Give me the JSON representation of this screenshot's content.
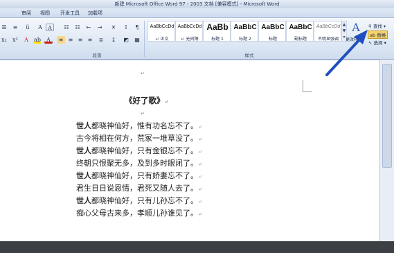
{
  "window": {
    "title": "新建 Microsoft Office Word 97 - 2003 文档 [兼容模式] - Microsoft Word"
  },
  "tabs": [
    "审阅",
    "视图",
    "开发工具",
    "加载项"
  ],
  "ribbon": {
    "paragraph_group_label": "段落",
    "styles_group_label": "样式",
    "styles": [
      {
        "preview": "AaBbCcDd",
        "name": "↵ 正文"
      },
      {
        "preview": "AaBbCcDd",
        "name": "↵ 无间隔"
      },
      {
        "preview": "AaBb",
        "name": "标题 1"
      },
      {
        "preview": "AaBbC",
        "name": "标题 2"
      },
      {
        "preview": "AaBbC",
        "name": "标题"
      },
      {
        "preview": "AaBbC",
        "name": "副标题"
      },
      {
        "preview": "AaBbCcDd",
        "name": "不明显强调"
      }
    ],
    "change_styles_label": "更改样式",
    "edit": {
      "find_label": "查找",
      "replace_label": "替换",
      "select_label": "选择"
    }
  },
  "document": {
    "title": "《好了歌》",
    "lines": [
      {
        "bold": "世人",
        "rest": "都晓神仙好，惟有功名忘不了。"
      },
      {
        "bold": "",
        "rest": "古今将相在何方，荒冢一堆草没了。"
      },
      {
        "bold": "世人",
        "rest": "都晓神仙好，只有金银忘不了。"
      },
      {
        "bold": "",
        "rest": "终朝只恨聚无多，及到多时眼闭了。"
      },
      {
        "bold": "世人",
        "rest": "都晓神仙好，只有娇妻忘不了。"
      },
      {
        "bold": "",
        "rest": "君生日日说恩情，君死又随人去了。"
      },
      {
        "bold": "世人",
        "rest": "都晓神仙好，只有儿孙忘不了。"
      },
      {
        "bold": "",
        "rest": "痴心父母古来多，孝顺儿孙谁见了。"
      }
    ],
    "paragraph_mark": "↵"
  },
  "colors": {
    "arrow": "#1f4fbf",
    "highlight": "#f7d36b"
  }
}
